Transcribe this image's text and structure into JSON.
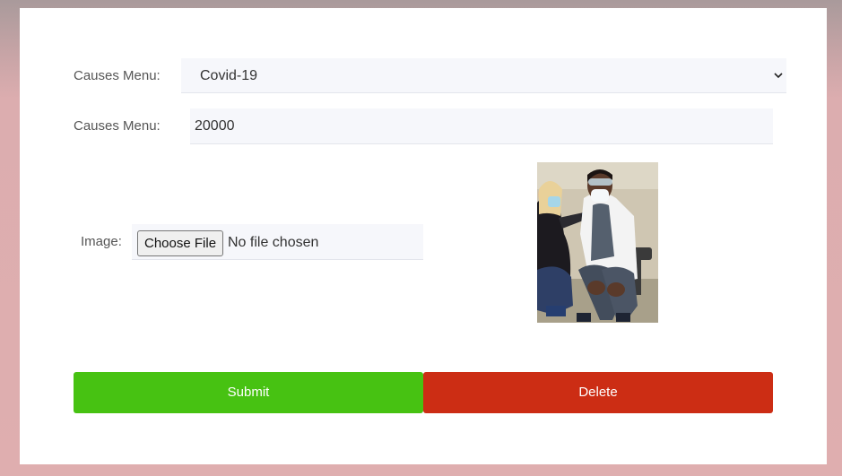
{
  "form": {
    "cause": {
      "label": "Causes Menu:",
      "selected": "Covid-19"
    },
    "amount": {
      "label": "Causes Menu:",
      "value": "20000"
    },
    "image": {
      "label": "Image:",
      "button_label": "Choose File",
      "status": "No file chosen"
    }
  },
  "actions": {
    "submit_label": "Submit",
    "delete_label": "Delete"
  },
  "colors": {
    "submit": "#47c212",
    "delete": "#cc2d14",
    "field_bg": "#f6f7fb"
  },
  "icons": {
    "select_caret": "chevron-down-icon"
  }
}
